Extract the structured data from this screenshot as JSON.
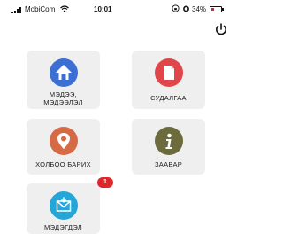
{
  "status_bar": {
    "carrier": "MobiCom",
    "time": "10:01",
    "battery_percent": "34%",
    "battery_level": 0.34
  },
  "tiles": [
    {
      "label_line1": "МЭДЭЭ,",
      "label_line2": "МЭДЭЭЛЭЛ",
      "icon": "home-icon",
      "color": "#3b6fd4"
    },
    {
      "label_line1": "СУДАЛГАА",
      "icon": "document-icon",
      "color": "#e0454a"
    },
    {
      "label_line1": "ХОЛБОО БАРИХ",
      "icon": "location-pin-icon",
      "color": "#d56a45"
    },
    {
      "label_line1": "ЗААВАР",
      "icon": "info-icon",
      "color": "#6b6b3e"
    },
    {
      "label_line1": "МЭДЭГДЭЛ",
      "icon": "mail-icon",
      "color": "#23a7d8",
      "badge": "1"
    }
  ]
}
